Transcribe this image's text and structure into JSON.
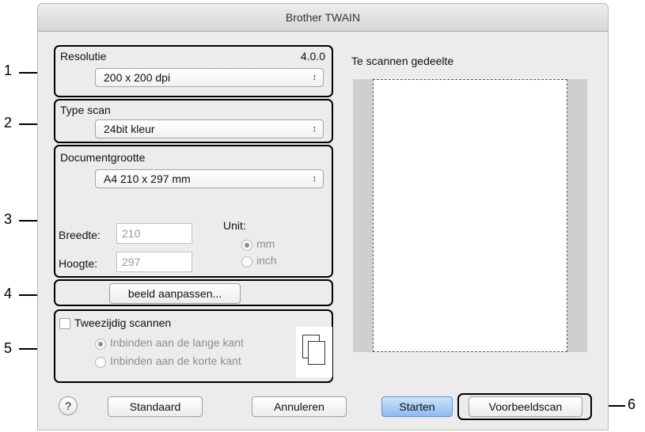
{
  "window": {
    "title": "Brother TWAIN"
  },
  "callouts": [
    "1",
    "2",
    "3",
    "4",
    "5",
    "6"
  ],
  "resolution": {
    "label": "Resolutie",
    "version": "4.0.0",
    "value": "200 x 200 dpi"
  },
  "scan_type": {
    "label": "Type scan",
    "value": "24bit kleur"
  },
  "doc_size": {
    "label": "Documentgrootte",
    "value": "A4  210 x 297 mm",
    "width_label": "Breedte:",
    "width_value": "210",
    "height_label": "Hoogte:",
    "height_value": "297",
    "unit_label": "Unit:",
    "unit_options": [
      "mm",
      "inch"
    ],
    "unit_selected": "mm"
  },
  "adjust_button": "beeld aanpassen...",
  "duplex": {
    "label": "Tweezijdig scannen",
    "checked": false,
    "options": [
      "Inbinden aan de lange kant",
      "Inbinden aan de korte kant"
    ],
    "selected": "Inbinden aan de lange kant"
  },
  "preview": {
    "label": "Te scannen gedeelte"
  },
  "buttons": {
    "help": "?",
    "default": "Standaard",
    "cancel": "Annuleren",
    "start": "Starten",
    "prescan": "Voorbeeldscan"
  },
  "colors": {
    "highlight_border": "#000000",
    "primary_button": "#8fbaf0",
    "window_bg": "#ececec"
  }
}
